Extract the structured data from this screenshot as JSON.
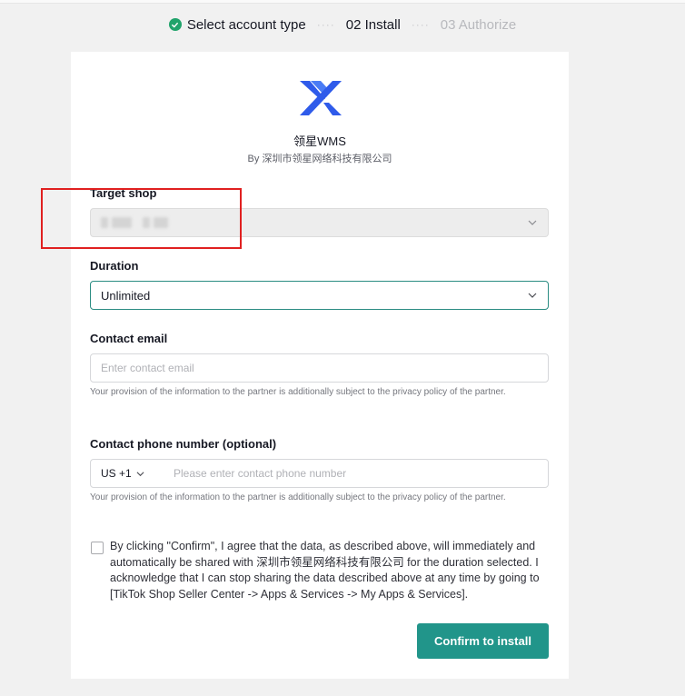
{
  "steps": {
    "step1": "Select account type",
    "step2": "02 Install",
    "step3": "03 Authorize"
  },
  "app": {
    "name": "领星WMS",
    "by": "By 深圳市领星网络科技有限公司"
  },
  "form": {
    "target_shop_label": "Target shop",
    "duration_label": "Duration",
    "duration_value": "Unlimited",
    "email_label": "Contact email",
    "email_placeholder": "Enter contact email",
    "email_helper": "Your provision of the information to the partner is additionally subject to the privacy policy of the partner.",
    "phone_label": "Contact phone number (optional)",
    "phone_code": "US +1",
    "phone_placeholder": "Please enter contact phone number",
    "phone_helper": "Your provision of the information to the partner is additionally subject to the privacy policy of the partner.",
    "consent": "By clicking \"Confirm\", I agree that the data, as described above, will immediately and automatically be shared with 深圳市领星网络科技有限公司 for the duration selected. I acknowledge that I can stop sharing the data described above at any time by going to [TikTok Shop Seller Center -> Apps & Services -> My Apps & Services].",
    "confirm_label": "Confirm to install"
  },
  "colors": {
    "accent": "#21958a",
    "step_done": "#20a36b",
    "logo_blue": "#2f5bea",
    "annotation": "#e02020"
  }
}
